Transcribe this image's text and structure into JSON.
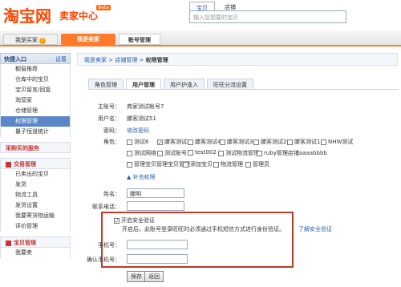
{
  "header": {
    "logo": "淘宝网",
    "logo_sub": "卖家中心",
    "beta": "Beta",
    "search_tabs": [
      "宝贝",
      "店铺"
    ],
    "search_placeholder": "输入您想要的宝贝"
  },
  "nav": {
    "buy_label": "我是买家",
    "sell_label": "我是卖家",
    "account_label": "账号管理"
  },
  "sidebar": {
    "quick_title": "快捷入口",
    "settings": "设置",
    "quick_items": [
      "橱窗推荐",
      "仓库中的宝贝",
      "宝贝留言/回复",
      "淘营家",
      "仓储管理",
      "权限管理",
      "量子恒道统计"
    ],
    "active_index": 5,
    "purchase_title": "采购买的服务",
    "trade_title": "交易管理",
    "trade_items": [
      "已卖出的宝贝",
      "发货",
      "物流工具",
      "发货设置",
      "我要寄货物运输",
      "评价管理"
    ],
    "item_title": "宝贝管理",
    "item_items": [
      "我要卖"
    ]
  },
  "breadcrumb": [
    "我是卖家",
    "店铺管理",
    "权限管理"
  ],
  "tabs": [
    "角色管理",
    "用户管理",
    "用户护逢入",
    "旺旺分流设置"
  ],
  "active_tab": 1,
  "form": {
    "main_account_label": "主账号：",
    "main_account_value": "商家测试帐号7",
    "username_label": "用户名：",
    "username_value": "滕客测试51",
    "password_label": "密码：",
    "password_link": "修改密码",
    "role_label": "角色：",
    "roles_row1": [
      "测试6",
      "滕客测试5",
      "滕客测试4",
      "滕客测试3",
      "滕客测试2",
      "滕客测试1",
      "NHW测试"
    ],
    "roles_row1_checked": [
      false,
      true,
      false,
      false,
      false,
      false,
      false
    ],
    "roles_row2": [
      "测试网络",
      "测试账号",
      "test002",
      "测试物流管理",
      "ruby管理店铺aaaabbbb"
    ],
    "roles_row3": [
      "管理宝贝管理宝贝管理",
      "添加宝贝",
      "物流管理",
      "管理员"
    ],
    "add_role_link": "▲ 补充权限",
    "name_label": "姓名：",
    "name_value": "滕明",
    "phone_label": "联系电话：",
    "phone_value": "",
    "security_enable": "开启安全验证",
    "security_desc": "开启后，此账号登录旺旺时必须通过手机短信方式进行身份验证。",
    "security_link": "了解安全验证",
    "mobile_label": "手机号：",
    "mobile_value": "",
    "confirm_mobile_label": "确认手机号：",
    "confirm_mobile_value": "",
    "save_button": "保存",
    "back_button": "返回"
  },
  "colors": {
    "brand": "#ff4400",
    "nav_active": "#ff7a2a",
    "highlight_box": "#c0392b",
    "sidebar_active": "#5b86c8"
  }
}
